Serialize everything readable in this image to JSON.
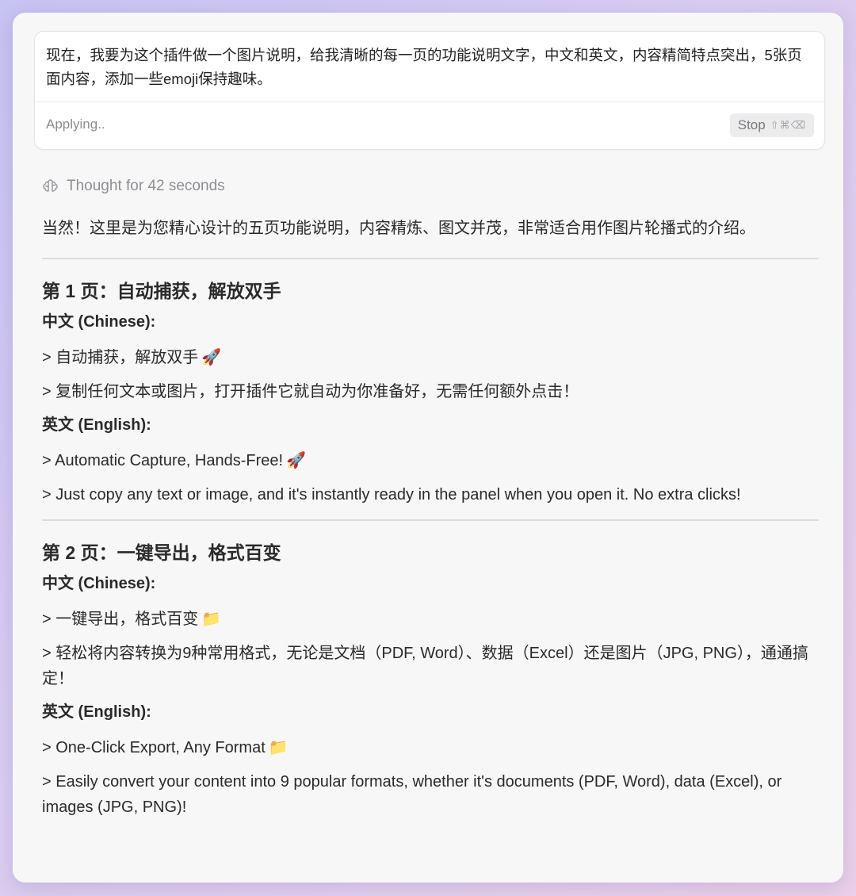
{
  "prompt": {
    "text": "现在，我要为这个插件做一个图片说明，给我清晰的每一页的功能说明文字，中文和英文，内容精简特点突出，5张页面内容，添加一些emoji保持趣味。",
    "status": "Applying..",
    "stop_label": "Stop",
    "stop_shortcut": "⇧⌘⌫"
  },
  "thought": {
    "label": "Thought for 42 seconds",
    "icon": "brain-icon"
  },
  "response": {
    "intro": "当然！这里是为您精心设计的五页功能说明，内容精炼、图文并茂，非常适合用作图片轮播式的介绍。",
    "sections": [
      {
        "title": "第 1 页：自动捕获，解放双手",
        "zh_label": "中文 (Chinese):",
        "zh_lines": [
          {
            "text": "> 自动捕获，解放双手",
            "emoji": "🚀"
          },
          {
            "text": "> 复制任何文本或图片，打开插件它就自动为你准备好，无需任何额外点击！",
            "emoji": ""
          }
        ],
        "en_label": "英文 (English):",
        "en_lines": [
          {
            "text": "> Automatic Capture, Hands-Free!",
            "emoji": "🚀"
          },
          {
            "text": "> Just copy any text or image, and it's instantly ready in the panel when you open it. No extra clicks!",
            "emoji": ""
          }
        ]
      },
      {
        "title": "第 2 页：一键导出，格式百变",
        "zh_label": "中文 (Chinese):",
        "zh_lines": [
          {
            "text": "> 一键导出，格式百变",
            "emoji": "📁"
          },
          {
            "text": "> 轻松将内容转换为9种常用格式，无论是文档（PDF, Word）、数据（Excel）还是图片（JPG, PNG），通通搞定！",
            "emoji": ""
          }
        ],
        "en_label": "英文 (English):",
        "en_lines": [
          {
            "text": "> One-Click Export, Any Format",
            "emoji": "📁"
          },
          {
            "text": "> Easily convert your content into 9 popular formats, whether it's documents (PDF, Word), data (Excel), or images (JPG, PNG)!",
            "emoji": ""
          }
        ]
      }
    ]
  },
  "colors": {
    "accent_bg": "#c7c3f2",
    "panel_bg": "#f7f7f8",
    "muted_text": "#8e8e93"
  }
}
